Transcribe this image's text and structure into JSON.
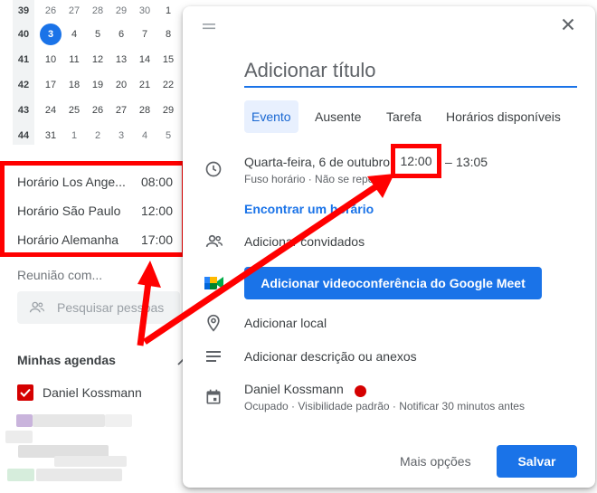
{
  "mini_calendar": {
    "weeks": [
      {
        "num": "39",
        "days": [
          "26",
          "27",
          "28",
          "29",
          "30",
          "1"
        ],
        "muted": [
          true,
          true,
          true,
          true,
          true,
          false
        ]
      },
      {
        "num": "40",
        "days": [
          "3",
          "4",
          "5",
          "6",
          "7",
          "8"
        ],
        "muted": [
          false,
          false,
          false,
          false,
          false,
          false
        ]
      },
      {
        "num": "41",
        "days": [
          "10",
          "11",
          "12",
          "13",
          "14",
          "15"
        ],
        "muted": [
          false,
          false,
          false,
          false,
          false,
          false
        ]
      },
      {
        "num": "42",
        "days": [
          "17",
          "18",
          "19",
          "20",
          "21",
          "22"
        ],
        "muted": [
          false,
          false,
          false,
          false,
          false,
          false
        ]
      },
      {
        "num": "43",
        "days": [
          "24",
          "25",
          "26",
          "27",
          "28",
          "29"
        ],
        "muted": [
          false,
          false,
          false,
          false,
          false,
          false
        ]
      },
      {
        "num": "44",
        "days": [
          "31",
          "1",
          "2",
          "3",
          "4",
          "5"
        ],
        "muted": [
          false,
          true,
          true,
          true,
          true,
          true
        ]
      }
    ],
    "today": "3"
  },
  "timezones": [
    {
      "name": "Horário Los Ange...",
      "time": "08:00"
    },
    {
      "name": "Horário São Paulo",
      "time": "12:00"
    },
    {
      "name": "Horário Alemanha",
      "time": "17:00"
    }
  ],
  "sidebar": {
    "meeting_label": "Reunião com...",
    "people_search_placeholder": "Pesquisar pessoas",
    "my_calendars": "Minhas agendas",
    "calendar_name": "Daniel Kossmann"
  },
  "dialog": {
    "title_placeholder": "Adicionar título",
    "tabs": [
      "Evento",
      "Ausente",
      "Tarefa",
      "Horários disponíveis"
    ],
    "active_tab": "Evento",
    "date": "Quarta-feira, 6 de outubro",
    "start_time": "12:00",
    "dash": "–",
    "end_time": "13:05",
    "time_sub": "Fuso horário · Não se repete",
    "find_time": "Encontrar um horário",
    "add_guests": "Adicionar convidados",
    "meet_button": "Adicionar videoconferência do Google Meet",
    "add_location": "Adicionar local",
    "add_description": "Adicionar descrição ou anexos",
    "owner_name": "Daniel Kossmann",
    "owner_sub": "Ocupado · Visibilidade padrão · Notificar 30 minutos antes",
    "more_options": "Mais opções",
    "save": "Salvar"
  },
  "colors": {
    "accent": "#1a73e8",
    "annotation": "#ff0000",
    "calendar_color": "#d50000"
  },
  "icons": [
    "drag-handle-icon",
    "close-icon",
    "clock-icon",
    "people-icon",
    "google-meet-icon",
    "location-pin-icon",
    "notes-icon",
    "calendar-icon",
    "chevron-up-icon",
    "people-search-icon",
    "checkbox-checked-icon"
  ]
}
